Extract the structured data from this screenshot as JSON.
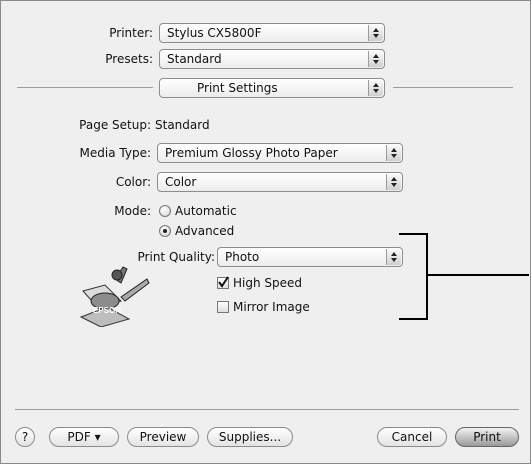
{
  "printer": {
    "label": "Printer:",
    "value": "Stylus CX5800F"
  },
  "presets": {
    "label": "Presets:",
    "value": "Standard"
  },
  "panel_selector": {
    "value": "Print Settings"
  },
  "page_setup": {
    "label": "Page Setup:",
    "value": "Standard"
  },
  "media_type": {
    "label": "Media Type:",
    "value": "Premium Glossy Photo Paper"
  },
  "color": {
    "label": "Color:",
    "value": "Color"
  },
  "mode": {
    "label": "Mode:",
    "options": [
      {
        "label": "Automatic",
        "selected": false
      },
      {
        "label": "Advanced",
        "selected": true
      }
    ]
  },
  "print_quality": {
    "label": "Print Quality:",
    "value": "Photo"
  },
  "checkboxes": [
    {
      "label": "High Speed",
      "checked": true
    },
    {
      "label": "Mirror Image",
      "checked": false
    }
  ],
  "logo": {
    "text": "EPSON"
  },
  "buttons": {
    "help": "?",
    "pdf": "PDF",
    "preview": "Preview",
    "supplies": "Supplies...",
    "cancel": "Cancel",
    "print": "Print"
  }
}
